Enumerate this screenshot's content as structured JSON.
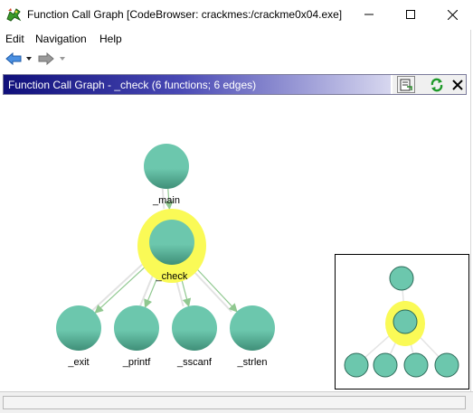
{
  "window": {
    "title": "Function Call Graph [CodeBrowser: crackmes:/crackme0x04.exe]",
    "controls": [
      "minimize",
      "maximize",
      "close"
    ]
  },
  "menu": {
    "items": [
      "Edit",
      "Navigation",
      "Help"
    ]
  },
  "toolbar": {
    "icons": [
      "back-arrow-icon",
      "forward-arrow-icon"
    ]
  },
  "panel": {
    "title": "Function Call Graph - _check (6 functions; 6 edges)",
    "actions": [
      "export-graph-icon",
      "refresh-icon",
      "close-icon"
    ]
  },
  "graph": {
    "colors": {
      "node": "#6cc7ad",
      "node_shadow": "#3f8f78",
      "highlight": "#fafa56",
      "edge": "#90c890"
    },
    "nodes": [
      {
        "id": "main",
        "label": "_main"
      },
      {
        "id": "check",
        "label": "_check",
        "selected": true
      },
      {
        "id": "exit",
        "label": "_exit"
      },
      {
        "id": "printf",
        "label": "_printf"
      },
      {
        "id": "sscanf",
        "label": "_sscanf"
      },
      {
        "id": "strlen",
        "label": "_strlen"
      }
    ],
    "edges": [
      {
        "from": "main",
        "to": "check"
      },
      {
        "from": "check",
        "to": "exit"
      },
      {
        "from": "check",
        "to": "printf"
      },
      {
        "from": "check",
        "to": "sscanf"
      },
      {
        "from": "check",
        "to": "strlen"
      }
    ]
  },
  "status": {
    "text": ""
  }
}
